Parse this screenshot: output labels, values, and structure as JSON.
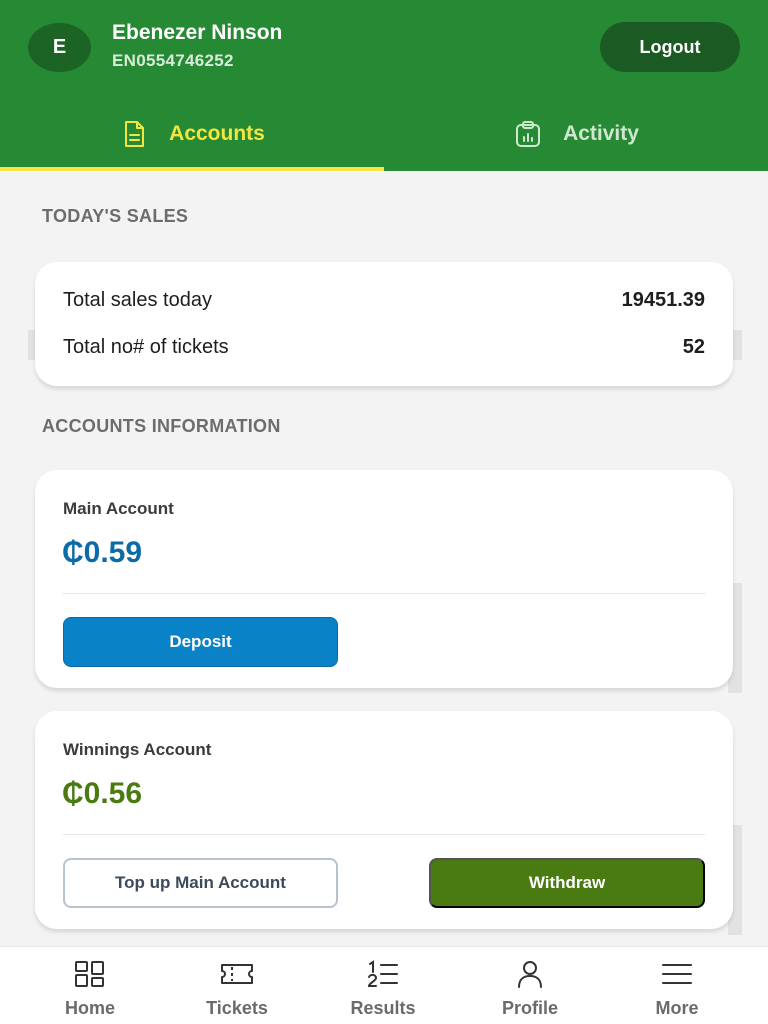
{
  "header": {
    "avatar_initial": "E",
    "user_name": "Ebenezer Ninson",
    "user_id": "EN0554746252",
    "logout_label": "Logout"
  },
  "tabs": [
    {
      "label": "Accounts",
      "icon": "document-icon",
      "active": true
    },
    {
      "label": "Activity",
      "icon": "clipboard-chart-icon",
      "active": false
    }
  ],
  "todays_sales": {
    "title": "TODAY'S SALES",
    "rows": [
      {
        "label": "Total sales today",
        "value": "19451.39"
      },
      {
        "label": "Total no# of tickets",
        "value": "52"
      }
    ]
  },
  "accounts": {
    "title": "ACCOUNTS INFORMATION",
    "main": {
      "title": "Main Account",
      "amount": "₵0.59",
      "deposit_label": "Deposit"
    },
    "winnings": {
      "title": "Winnings Account",
      "amount": "₵0.56",
      "topup_label": "Top up Main Account",
      "withdraw_label": "Withdraw"
    }
  },
  "bottom_nav": [
    {
      "label": "Home",
      "icon": "grid-icon"
    },
    {
      "label": "Tickets",
      "icon": "ticket-icon"
    },
    {
      "label": "Results",
      "icon": "numbered-list-icon"
    },
    {
      "label": "Profile",
      "icon": "person-icon"
    },
    {
      "label": "More",
      "icon": "menu-icon"
    }
  ],
  "colors": {
    "header_green": "#268a35",
    "active_tab_yellow": "#f3e640",
    "main_amount_blue": "#0b6aa8",
    "winnings_amount_green": "#4a7a12",
    "deposit_blue": "#0a82c8",
    "withdraw_green": "#4a7a12"
  }
}
